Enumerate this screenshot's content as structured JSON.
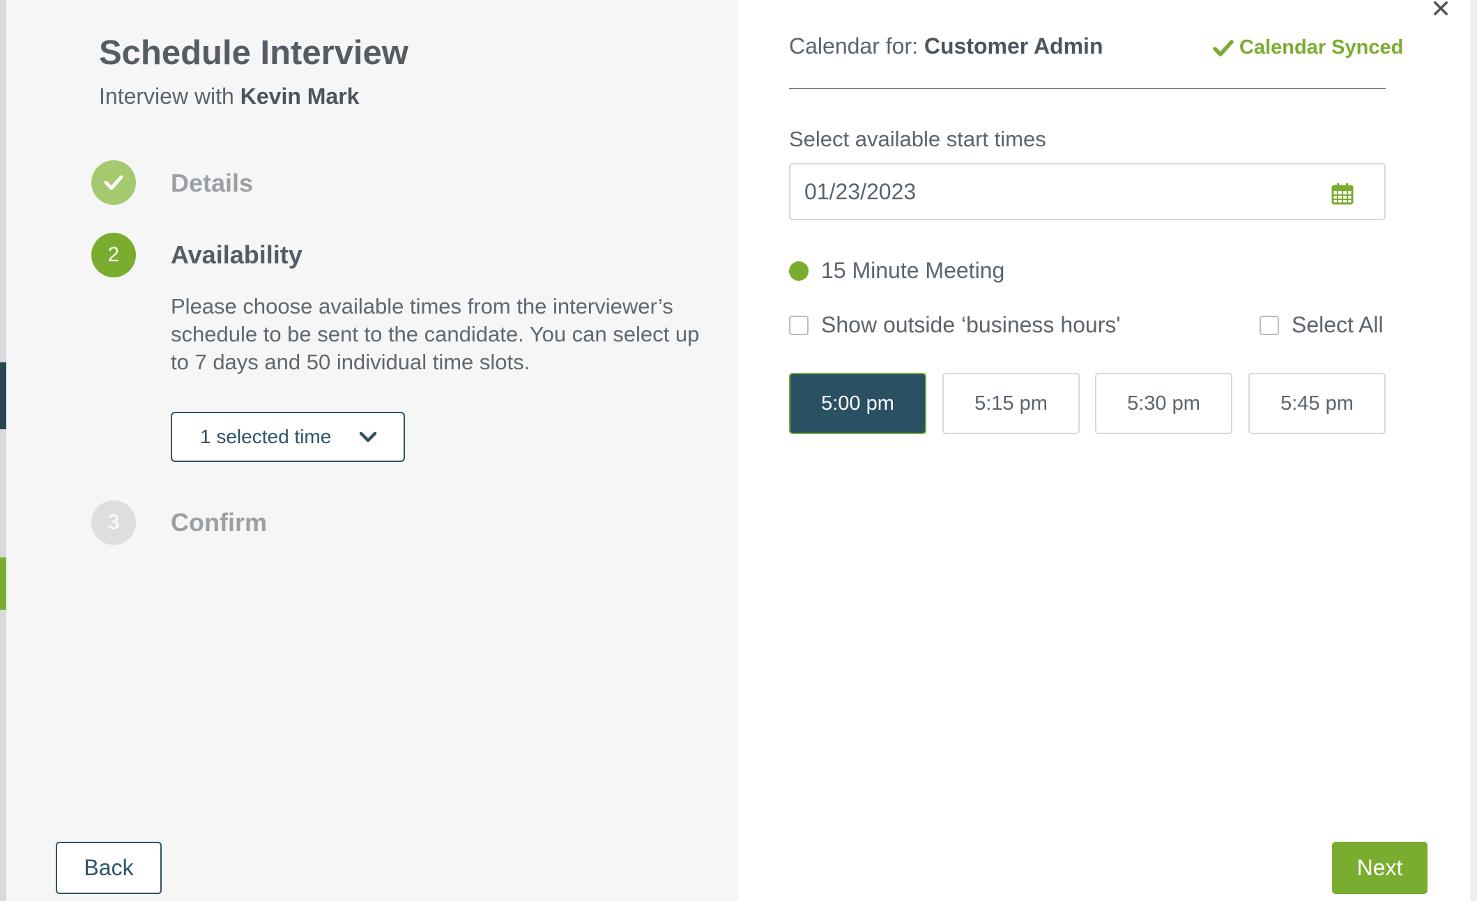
{
  "colors": {
    "accent": "#7aad2f",
    "primary": "#2e5366",
    "selected_slot": "#2a5063"
  },
  "close_icon": "close-icon",
  "header": {
    "title": "Schedule Interview",
    "subtitle_prefix": "Interview with",
    "candidate_name": "Kevin Mark"
  },
  "steps": [
    {
      "number": "",
      "icon": "check-icon",
      "label": "Details",
      "status": "complete"
    },
    {
      "number": "2",
      "label": "Availability",
      "status": "active",
      "description": "Please choose available times from the interviewer’s schedule to be sent to the candidate. You can select up to 7 days and 50 individual time slots."
    },
    {
      "number": "3",
      "label": "Confirm",
      "status": "pending"
    }
  ],
  "selected_times_dropdown": {
    "label": "1 selected time",
    "icon": "chevron-down-icon"
  },
  "calendar": {
    "label": "Calendar for:",
    "owner": "Customer Admin",
    "sync_status": "Calendar Synced"
  },
  "date_field": {
    "label": "Select available start times",
    "value": "01/23/2023",
    "icon": "calendar-icon"
  },
  "meeting_type": "15 Minute Meeting",
  "options": {
    "outside_hours_label": "Show outside ‘business hours'",
    "select_all_label": "Select All"
  },
  "time_slots": [
    {
      "label": "5:00 pm",
      "selected": true
    },
    {
      "label": "5:15 pm",
      "selected": false
    },
    {
      "label": "5:30 pm",
      "selected": false
    },
    {
      "label": "5:45 pm",
      "selected": false
    }
  ],
  "footer": {
    "back_label": "Back",
    "next_label": "Next"
  }
}
